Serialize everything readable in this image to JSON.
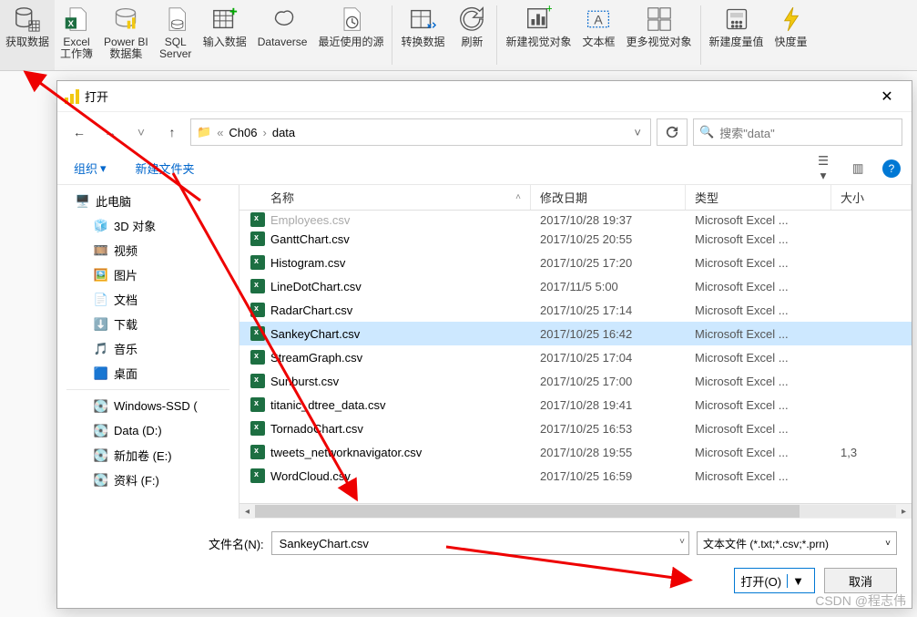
{
  "ribbon": {
    "items": [
      {
        "label": "获取数据",
        "icon": "database"
      },
      {
        "label": "Excel\n工作簿",
        "icon": "excel"
      },
      {
        "label": "Power BI\n数据集",
        "icon": "pbi"
      },
      {
        "label": "SQL\nServer",
        "icon": "sql"
      },
      {
        "label": "输入数据",
        "icon": "table-plus"
      },
      {
        "label": "Dataverse",
        "icon": "dataverse"
      },
      {
        "label": "最近使用的源",
        "icon": "recent"
      },
      {
        "label": "转换数据",
        "icon": "transform"
      },
      {
        "label": "刷新",
        "icon": "refresh"
      },
      {
        "label": "新建视觉对象",
        "icon": "visual"
      },
      {
        "label": "文本框",
        "icon": "textbox"
      },
      {
        "label": "更多视觉对象",
        "icon": "more-visuals"
      },
      {
        "label": "新建度量值",
        "icon": "measure"
      },
      {
        "label": "快度量",
        "icon": "quick-measure"
      }
    ]
  },
  "dialog": {
    "title": "打开",
    "breadcrumb": [
      "Ch06",
      "data"
    ],
    "search_placeholder": "搜索\"data\"",
    "toolbar": {
      "organize": "组织",
      "newfolder": "新建文件夹"
    },
    "sidebar": [
      {
        "label": "此电脑",
        "icon": "pc",
        "sub": false
      },
      {
        "label": "3D 对象",
        "icon": "3d",
        "sub": true
      },
      {
        "label": "视频",
        "icon": "video",
        "sub": true
      },
      {
        "label": "图片",
        "icon": "pictures",
        "sub": true
      },
      {
        "label": "文档",
        "icon": "docs",
        "sub": true
      },
      {
        "label": "下载",
        "icon": "downloads",
        "sub": true
      },
      {
        "label": "音乐",
        "icon": "music",
        "sub": true
      },
      {
        "label": "桌面",
        "icon": "desktop",
        "sub": true
      },
      {
        "label": "Windows-SSD (",
        "icon": "drive",
        "sub": true
      },
      {
        "label": "Data (D:)",
        "icon": "drive",
        "sub": true
      },
      {
        "label": "新加卷 (E:)",
        "icon": "drive",
        "sub": true
      },
      {
        "label": "资料 (F:)",
        "icon": "drive",
        "sub": true
      }
    ],
    "columns": {
      "name": "名称",
      "date": "修改日期",
      "type": "类型",
      "size": "大小"
    },
    "files": [
      {
        "name": "Employees.csv",
        "date": "2017/10/28 19:37",
        "type": "Microsoft Excel ...",
        "size": "",
        "cutoff": true
      },
      {
        "name": "GanttChart.csv",
        "date": "2017/10/25 20:55",
        "type": "Microsoft Excel ...",
        "size": ""
      },
      {
        "name": "Histogram.csv",
        "date": "2017/10/25 17:20",
        "type": "Microsoft Excel ...",
        "size": ""
      },
      {
        "name": "LineDotChart.csv",
        "date": "2017/11/5 5:00",
        "type": "Microsoft Excel ...",
        "size": ""
      },
      {
        "name": "RadarChart.csv",
        "date": "2017/10/25 17:14",
        "type": "Microsoft Excel ...",
        "size": ""
      },
      {
        "name": "SankeyChart.csv",
        "date": "2017/10/25 16:42",
        "type": "Microsoft Excel ...",
        "size": "",
        "selected": true
      },
      {
        "name": "StreamGraph.csv",
        "date": "2017/10/25 17:04",
        "type": "Microsoft Excel ...",
        "size": ""
      },
      {
        "name": "Sunburst.csv",
        "date": "2017/10/25 17:00",
        "type": "Microsoft Excel ...",
        "size": ""
      },
      {
        "name": "titanic_dtree_data.csv",
        "date": "2017/10/28 19:41",
        "type": "Microsoft Excel ...",
        "size": ""
      },
      {
        "name": "TornadoChart.csv",
        "date": "2017/10/25 16:53",
        "type": "Microsoft Excel ...",
        "size": ""
      },
      {
        "name": "tweets_networknavigator.csv",
        "date": "2017/10/28 19:55",
        "type": "Microsoft Excel ...",
        "size": "1,3"
      },
      {
        "name": "WordCloud.csv",
        "date": "2017/10/25 16:59",
        "type": "Microsoft Excel ...",
        "size": ""
      }
    ],
    "footer": {
      "filename_label": "文件名(N):",
      "filename_value": "SankeyChart.csv",
      "filter": "文本文件 (*.txt;*.csv;*.prn)",
      "open": "打开(O)",
      "cancel": "取消"
    }
  },
  "watermark": "CSDN @程志伟"
}
